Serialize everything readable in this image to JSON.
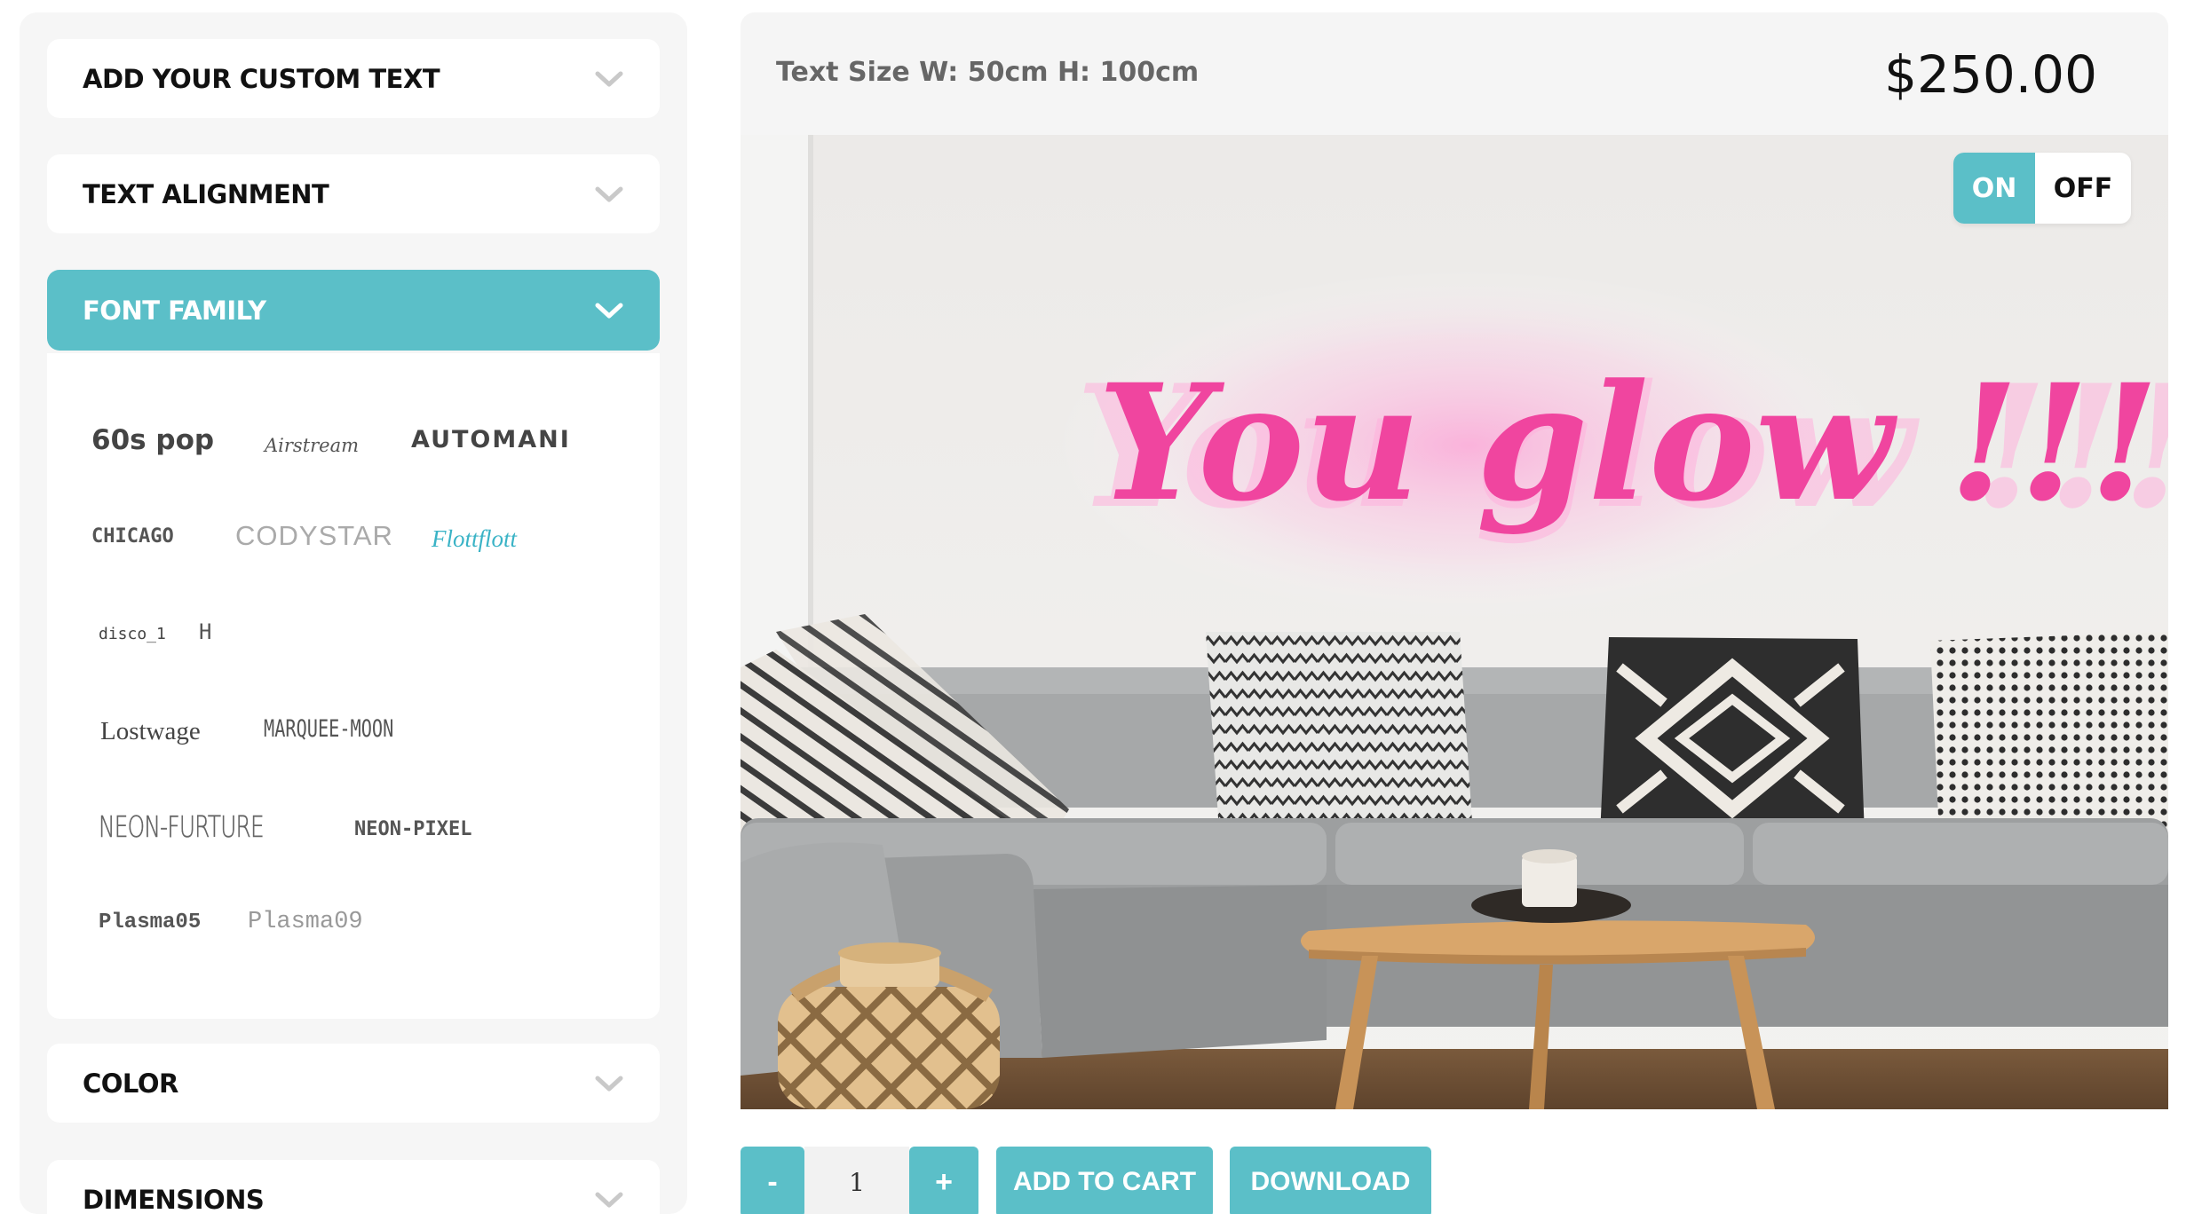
{
  "accordion": {
    "custom_text": "ADD YOUR CUSTOM TEXT",
    "text_alignment": "TEXT ALIGNMENT",
    "font_family": "FONT FAMILY",
    "color": "COLOR",
    "dimensions": "DIMENSIONS"
  },
  "fonts": [
    "60s pop",
    "Airstream",
    "AUTOMANI",
    "CHICAGO",
    "CODYSTAR",
    "Flottflott",
    "disco_1",
    "H",
    "Lostwage",
    "MARQUEE-MOON",
    "NEON-FURTURE",
    "NEON-PIXEL",
    "Plasma05",
    "Plasma09"
  ],
  "header": {
    "size_label": "Text Size W: 50cm H: 100cm",
    "price": "$250.00"
  },
  "preview": {
    "neon_text": "You glow !!!",
    "neon_color": "#f0459f",
    "toggle_on": "ON",
    "toggle_off": "OFF"
  },
  "controls": {
    "minus": "-",
    "quantity": "1",
    "plus": "+",
    "add_to_cart": "ADD TO CART",
    "download": "DOWNLOAD"
  },
  "colors": {
    "accent": "#5bbfc8",
    "panel_bg": "#f6f6f6"
  }
}
